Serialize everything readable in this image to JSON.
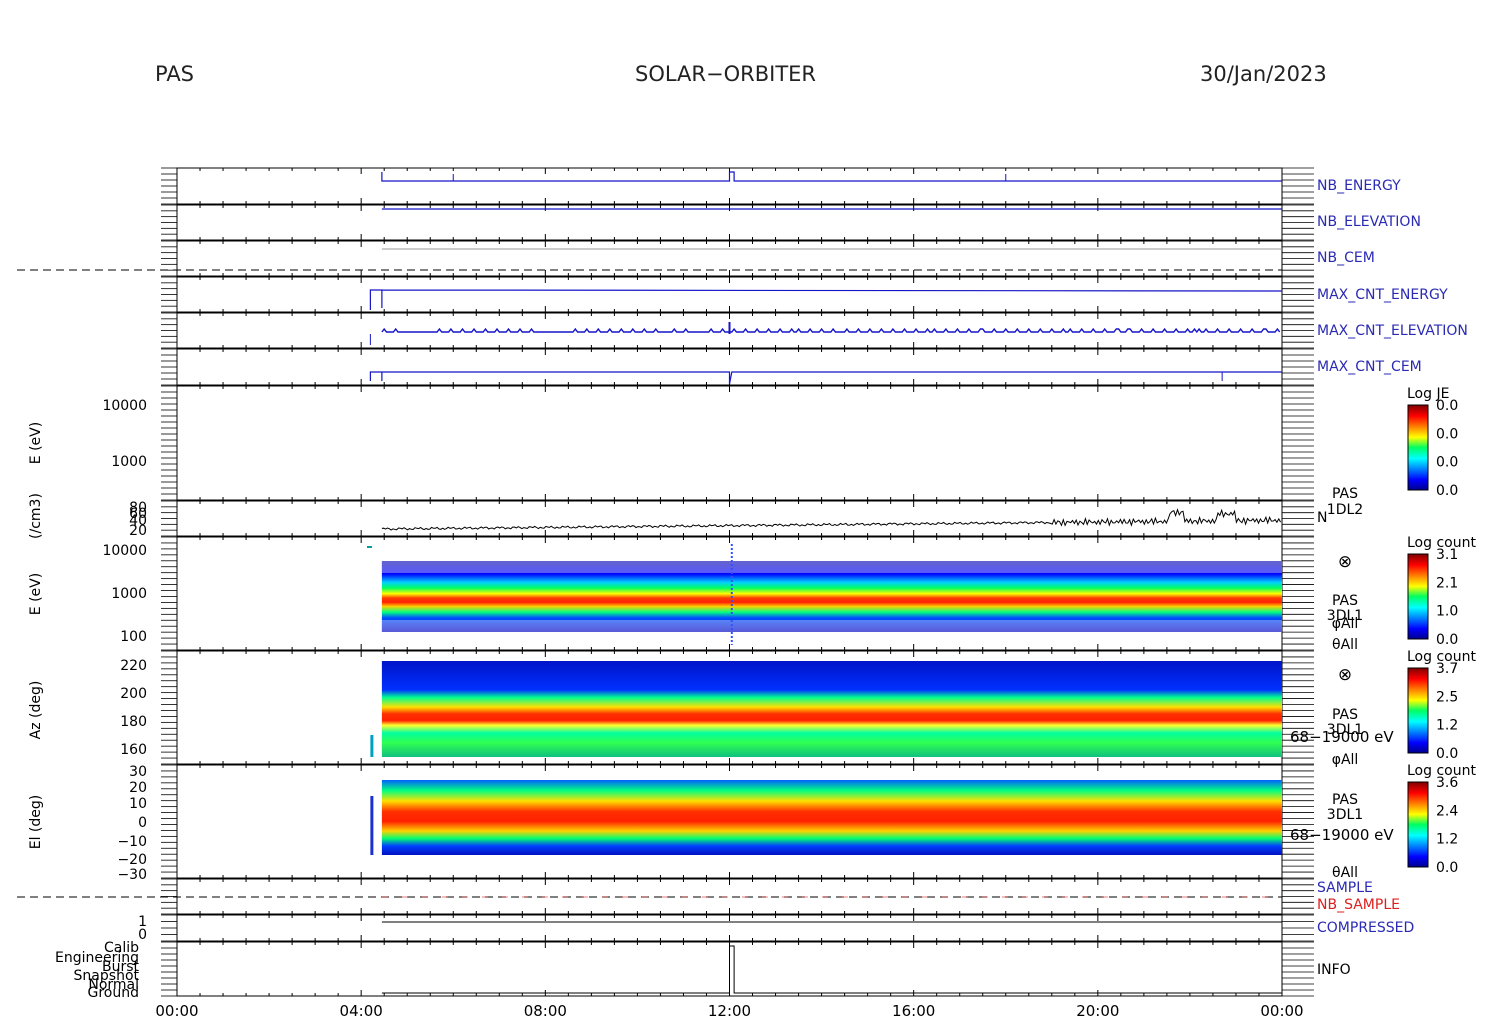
{
  "header": {
    "instrument": "PAS",
    "mission": "SOLAR−ORBITER",
    "date": "30/Jan/2023"
  },
  "x_axis": {
    "tick_labels": [
      "00:00",
      "04:00",
      "08:00",
      "12:00",
      "16:00",
      "20:00",
      "00:00"
    ],
    "hours": [
      0,
      4,
      8,
      12,
      16,
      20,
      24
    ],
    "range_hours": [
      0,
      24
    ]
  },
  "side_labels": {
    "nb_energy": "NB_ENERGY",
    "nb_elevation": "NB_ELEVATION",
    "nb_cem": "NB_CEM",
    "max_cnt_energy": "MAX_CNT_ENERGY",
    "max_cnt_elevation": "MAX_CNT_ELEVATION",
    "max_cnt_cem": "MAX_CNT_CEM",
    "pas_1": "PAS",
    "dl2": "1DL2",
    "n": "N",
    "pas_2": "PAS",
    "dl1_a": "3DL1",
    "phi_all_a": "φAll",
    "theta_all_a": "θAll",
    "pas_3": "PAS",
    "dl1_b": "3DL1",
    "erange_a": "68−19000 eV",
    "phi_all_b": "φAll",
    "pas_4": "PAS",
    "dl1_c": "3DL1",
    "erange_b": "68−19000 eV",
    "theta_all_b": "θAll",
    "sample": "SAMPLE",
    "nb_sample": "NB_SAMPLE",
    "compressed": "COMPRESSED",
    "info": "INFO",
    "otimes": "⊗"
  },
  "axis_labels": {
    "energy_top": "E (eV)",
    "density": "(/cm3)",
    "energy_spec": "E (eV)",
    "azimuth": "Az (deg)",
    "elevation": "El (deg)"
  },
  "ticks": {
    "energy_top": [
      "10000",
      "1000"
    ],
    "density": [
      "80",
      "60",
      "40",
      "20"
    ],
    "energy_spec": [
      "10000",
      "1000",
      "100"
    ],
    "azimuth": [
      "220",
      "200",
      "180",
      "160"
    ],
    "elevation": [
      "30",
      "20",
      "10",
      "0",
      "−10",
      "−20",
      "−30"
    ],
    "compressed": [
      "1",
      "0"
    ],
    "info": [
      "Calib",
      "Engineering",
      "Burst",
      "Snapshot",
      "Normal",
      "Ground"
    ]
  },
  "colorbars": [
    {
      "title": "Log JE",
      "labels": [
        "0.0",
        "0.0",
        "0.0",
        "0.0"
      ]
    },
    {
      "title": "Log count",
      "labels": [
        "3.1",
        "2.1",
        "1.0",
        "0.0"
      ]
    },
    {
      "title": "Log count",
      "labels": [
        "3.7",
        "2.5",
        "1.2",
        "0.0"
      ]
    },
    {
      "title": "Log count",
      "labels": [
        "3.6",
        "2.4",
        "1.2",
        "0.0"
      ]
    }
  ],
  "colors": {
    "trace_blue": "#1414c8",
    "label_blue": "#2a2ab4",
    "label_red": "#dc2020",
    "axis": "#000000"
  },
  "chart_data": {
    "type": "heatmap",
    "panels": [
      {
        "name": "NB_ENERGY",
        "data_start_hour": 4.45,
        "level": 0.1
      },
      {
        "name": "NB_ELEVATION",
        "data_start_hour": 4.45,
        "level": 0.1
      },
      {
        "name": "NB_CEM",
        "data_start_hour": 4.45,
        "level": 0.1
      },
      {
        "name": "MAX_CNT_ENERGY",
        "data_start_hour": 4.45,
        "level": 0.1
      },
      {
        "name": "MAX_CNT_ELEVATION",
        "data_start_hour": 4.45
      },
      {
        "name": "MAX_CNT_CEM",
        "data_start_hour": 4.45
      },
      {
        "name": "N",
        "data_start_hour": 4.45,
        "y_range": [
          20,
          80
        ]
      },
      {
        "name": "E spectrogram",
        "y_scale": "log",
        "y_range": [
          70,
          15000
        ],
        "band_energy_eV": 500
      },
      {
        "name": "Az spectrogram",
        "y_range": [
          150,
          225
        ],
        "peak_deg": 182
      },
      {
        "name": "El spectrogram",
        "y_range": [
          -30,
          30
        ],
        "peak_deg": 3
      }
    ]
  }
}
